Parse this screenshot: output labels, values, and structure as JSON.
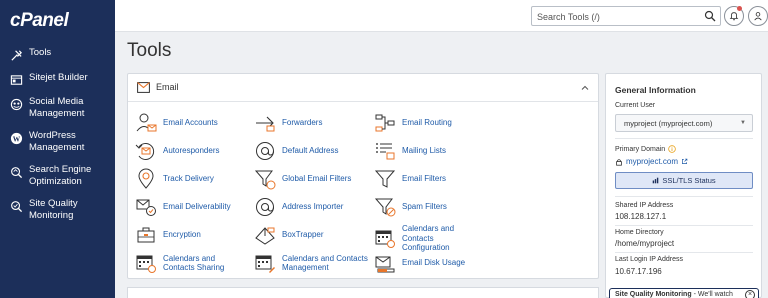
{
  "logo": "cPanel",
  "sidebar": {
    "items": [
      {
        "label": "Tools",
        "icon": "tools-icon"
      },
      {
        "label": "Sitejet Builder",
        "icon": "sitejet-icon"
      },
      {
        "label": "Social Media Management",
        "icon": "social-media-icon"
      },
      {
        "label": "WordPress Management",
        "icon": "wordpress-icon"
      },
      {
        "label": "Search Engine Optimization",
        "icon": "seo-icon"
      },
      {
        "label": "Site Quality Monitoring",
        "icon": "site-quality-icon"
      }
    ]
  },
  "topbar": {
    "search_placeholder": "Search Tools (/)"
  },
  "page_title": "Tools",
  "email_panel": {
    "title": "Email",
    "tools": [
      {
        "label": "Email Accounts",
        "icon": "email-accounts-icon"
      },
      {
        "label": "Forwarders",
        "icon": "forwarders-icon"
      },
      {
        "label": "Email Routing",
        "icon": "email-routing-icon"
      },
      {
        "label": "Autoresponders",
        "icon": "autoresponders-icon"
      },
      {
        "label": "Default Address",
        "icon": "default-address-icon"
      },
      {
        "label": "Mailing Lists",
        "icon": "mailing-lists-icon"
      },
      {
        "label": "Track Delivery",
        "icon": "track-delivery-icon"
      },
      {
        "label": "Global Email Filters",
        "icon": "global-email-filters-icon"
      },
      {
        "label": "Email Filters",
        "icon": "email-filters-icon"
      },
      {
        "label": "Email Deliverability",
        "icon": "email-deliverability-icon"
      },
      {
        "label": "Address Importer",
        "icon": "address-importer-icon"
      },
      {
        "label": "Spam Filters",
        "icon": "spam-filters-icon"
      },
      {
        "label": "Encryption",
        "icon": "encryption-icon"
      },
      {
        "label": "BoxTrapper",
        "icon": "boxtrapper-icon"
      },
      {
        "label": "Calendars and Contacts Configuration",
        "icon": "calendars-config-icon"
      },
      {
        "label": "Calendars and Contacts Sharing",
        "icon": "calendars-sharing-icon"
      },
      {
        "label": "Calendars and Contacts Management",
        "icon": "calendars-management-icon"
      },
      {
        "label": "Email Disk Usage",
        "icon": "email-disk-usage-icon"
      }
    ]
  },
  "info": {
    "title": "General Information",
    "current_user_label": "Current User",
    "current_user": "myproject (myproject.com)",
    "primary_domain_label": "Primary Domain",
    "primary_domain": "myproject.com",
    "ssl_button": "SSL/TLS Status",
    "shared_ip_label": "Shared IP Address",
    "shared_ip": "108.128.127.1",
    "home_dir_label": "Home Directory",
    "home_dir": "/home/myproject",
    "last_login_label": "Last Login IP Address",
    "last_login": "10.67.17.196",
    "banner_bold": "Site Quality Monitoring",
    "banner_rest": " - We'll watch"
  },
  "colors": {
    "sidebar_bg": "#1c2f5a",
    "link": "#1f5ba8",
    "accent_orange": "#e8762b"
  }
}
